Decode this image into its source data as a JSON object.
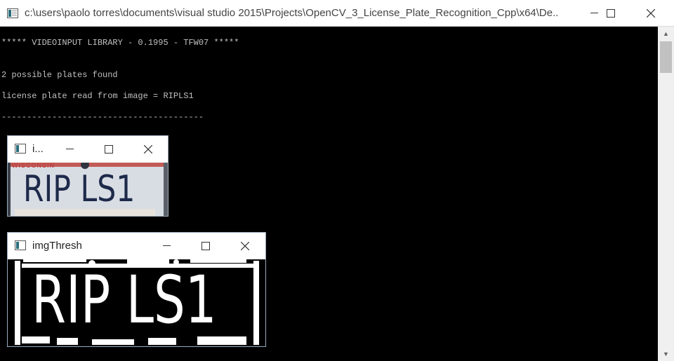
{
  "window": {
    "title": "c:\\users\\paolo torres\\documents\\visual studio 2015\\Projects\\OpenCV_3_License_Plate_Recognition_Cpp\\x64\\De...",
    "minimize_label": "",
    "maximize_label": "",
    "close_label": ""
  },
  "console": {
    "lines": [
      "***** VIDEOINPUT LIBRARY - 0.1995 - TFW07 *****",
      "2 possible plates found",
      "license plate read from image = RIPLS1",
      "----------------------------------------"
    ]
  },
  "image_window": {
    "title": "i...",
    "plate_text": "RIP LS1",
    "plate_top_text": "WISCONSIN"
  },
  "thresh_window": {
    "title": "imgThresh",
    "plate_text": "RIP LS1"
  },
  "colors": {
    "console_bg": "#000000",
    "console_text": "#c0c0c0",
    "plate_chars": "#1e2a4a",
    "thresh_fg": "#ffffff"
  },
  "icons": {
    "app": "console-app-icon",
    "minimize": "minimize-icon",
    "maximize": "maximize-icon",
    "close": "close-icon"
  }
}
